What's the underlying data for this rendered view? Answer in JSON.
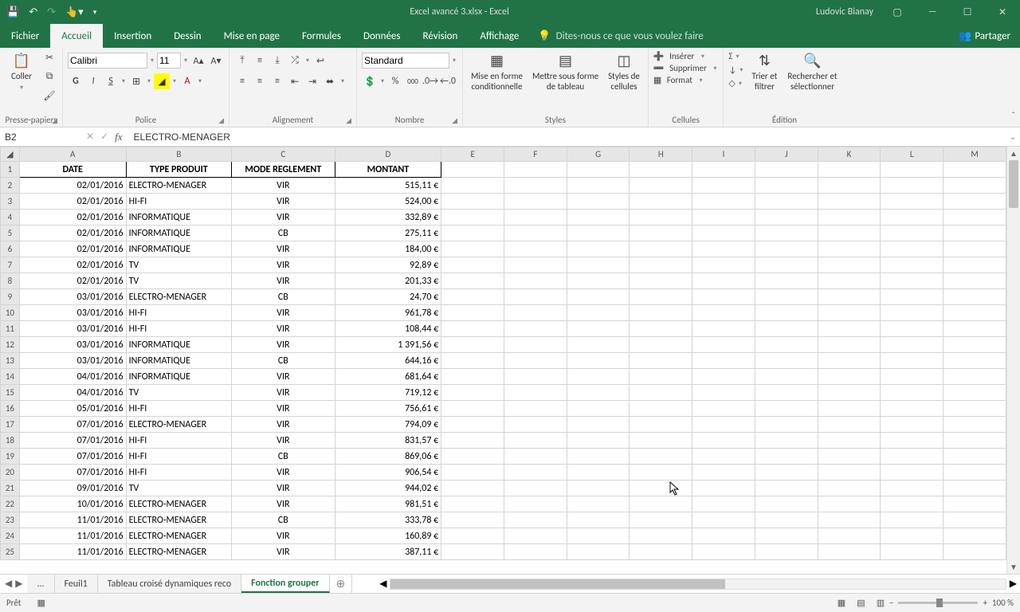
{
  "titlebar": {
    "document": "Excel avancé 3.xlsx - Excel",
    "user": "Ludovic Bianay"
  },
  "ribbon_tabs": [
    "Fichier",
    "Accueil",
    "Insertion",
    "Dessin",
    "Mise en page",
    "Formules",
    "Données",
    "Révision",
    "Affichage"
  ],
  "ribbon_active_tab": "Accueil",
  "tell_me": "Dites-nous ce que vous voulez faire",
  "share": "Partager",
  "ribbon": {
    "clipboard": {
      "paste": "Coller",
      "label": "Presse-papiers"
    },
    "font": {
      "name": "Calibri",
      "size": "11",
      "label": "Police",
      "bold": "G",
      "italic": "I",
      "underline": "S"
    },
    "alignment": {
      "label": "Alignement"
    },
    "number": {
      "format": "Standard",
      "label": "Nombre",
      "percent": "%",
      "thousands": "000"
    },
    "styles": {
      "cond": "Mise en forme\nconditionnelle",
      "table": "Mettre sous forme\nde tableau",
      "cell": "Styles de\ncellules",
      "label": "Styles"
    },
    "cells": {
      "insert": "Insérer",
      "delete": "Supprimer",
      "format": "Format",
      "label": "Cellules"
    },
    "editing": {
      "sum": "Σ",
      "fill": "↓",
      "clear": "◇",
      "sort": "Trier et\nfiltrer",
      "find": "Rechercher et\nsélectionner",
      "label": "Édition"
    }
  },
  "name_box": "B2",
  "formula": "ELECTRO-MENAGER",
  "columns": [
    "A",
    "B",
    "C",
    "D",
    "E",
    "F",
    "G",
    "H",
    "I",
    "J",
    "K",
    "L",
    "M"
  ],
  "headers": [
    "DATE",
    "TYPE PRODUIT",
    "MODE REGLEMENT",
    "MONTANT"
  ],
  "chart_data": {
    "type": "table",
    "columns": [
      "DATE",
      "TYPE PRODUIT",
      "MODE REGLEMENT",
      "MONTANT"
    ],
    "rows": [
      [
        "02/01/2016",
        "ELECTRO-MENAGER",
        "VIR",
        "515,11 €"
      ],
      [
        "02/01/2016",
        "HI-FI",
        "VIR",
        "524,00 €"
      ],
      [
        "02/01/2016",
        "INFORMATIQUE",
        "VIR",
        "332,89 €"
      ],
      [
        "02/01/2016",
        "INFORMATIQUE",
        "CB",
        "275,11 €"
      ],
      [
        "02/01/2016",
        "INFORMATIQUE",
        "VIR",
        "184,00 €"
      ],
      [
        "02/01/2016",
        "TV",
        "VIR",
        "92,89 €"
      ],
      [
        "02/01/2016",
        "TV",
        "VIR",
        "201,33 €"
      ],
      [
        "03/01/2016",
        "ELECTRO-MENAGER",
        "CB",
        "24,70 €"
      ],
      [
        "03/01/2016",
        "HI-FI",
        "VIR",
        "961,78 €"
      ],
      [
        "03/01/2016",
        "HI-FI",
        "VIR",
        "108,44 €"
      ],
      [
        "03/01/2016",
        "INFORMATIQUE",
        "VIR",
        "1 391,56 €"
      ],
      [
        "03/01/2016",
        "INFORMATIQUE",
        "CB",
        "644,16 €"
      ],
      [
        "04/01/2016",
        "INFORMATIQUE",
        "VIR",
        "681,64 €"
      ],
      [
        "04/01/2016",
        "TV",
        "VIR",
        "719,12 €"
      ],
      [
        "05/01/2016",
        "HI-FI",
        "VIR",
        "756,61 €"
      ],
      [
        "07/01/2016",
        "ELECTRO-MENAGER",
        "VIR",
        "794,09 €"
      ],
      [
        "07/01/2016",
        "HI-FI",
        "VIR",
        "831,57 €"
      ],
      [
        "07/01/2016",
        "HI-FI",
        "CB",
        "869,06 €"
      ],
      [
        "07/01/2016",
        "HI-FI",
        "VIR",
        "906,54 €"
      ],
      [
        "09/01/2016",
        "TV",
        "VIR",
        "944,02 €"
      ],
      [
        "10/01/2016",
        "ELECTRO-MENAGER",
        "VIR",
        "981,51 €"
      ],
      [
        "11/01/2016",
        "ELECTRO-MENAGER",
        "CB",
        "333,78 €"
      ],
      [
        "11/01/2016",
        "ELECTRO-MENAGER",
        "VIR",
        "160,89 €"
      ],
      [
        "11/01/2016",
        "ELECTRO-MENAGER",
        "VIR",
        "387,11 €"
      ]
    ]
  },
  "sheet_tabs": {
    "ellipsis": "...",
    "items": [
      "Feuil1",
      "Tableau croisé dynamiques reco",
      "Fonction grouper"
    ],
    "active": "Fonction grouper"
  },
  "status": {
    "ready": "Prêt",
    "zoom": "100 %"
  }
}
